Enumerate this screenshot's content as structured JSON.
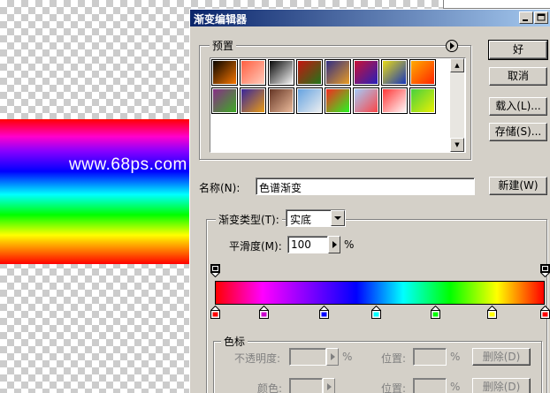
{
  "background": {
    "watermark": "www.68ps.com"
  },
  "dialog": {
    "title": "渐变编辑器",
    "presets": {
      "label": "预置",
      "swatches": [
        [
          "#000000",
          "#ff7a00"
        ],
        [
          "#ff5a3c",
          "#ffd0c0"
        ],
        [
          "#000000",
          "#ffffff"
        ],
        [
          "#cc1010",
          "#1a7a1a"
        ],
        [
          "#2a2a88",
          "#f0a020"
        ],
        [
          "#d01030",
          "#2020c0"
        ],
        [
          "#f0e010",
          "#1030c0"
        ],
        [
          "#ffb000",
          "#ff2000"
        ],
        [
          "#8a2a8a",
          "#3ab020"
        ],
        [
          "#3020a0",
          "#f0a010"
        ],
        [
          "#603020",
          "#f0c0a0"
        ],
        [
          "#60a0e0",
          "#f0f0f0"
        ],
        [
          "#ff2020",
          "#20ff20"
        ],
        [
          "#a0d0ff",
          "#ff4040"
        ],
        [
          "#ff3030",
          "#ffffff"
        ],
        [
          "#40d040",
          "#f0f000"
        ]
      ]
    },
    "buttons": {
      "ok": "好",
      "cancel": "取消",
      "load": "载入(L)...",
      "save": "存储(S)...",
      "new": "新建(W)"
    },
    "name": {
      "label": "名称(N):",
      "value": "色谱渐变"
    },
    "gradient_type": {
      "label": "渐变类型(T):",
      "value": "实底"
    },
    "smoothness": {
      "label": "平滑度(M):",
      "value": "100",
      "unit": "%"
    },
    "gradient": {
      "colors": [
        "#ff0000",
        "#ff00ff",
        "#8000ff",
        "#0000ff",
        "#00ffff",
        "#00ff00",
        "#ffff00",
        "#ff0000"
      ],
      "color_stops": [
        {
          "pos": 0,
          "color": "#ff0000"
        },
        {
          "pos": 15,
          "color": "#cc00cc"
        },
        {
          "pos": 33,
          "color": "#0000ff"
        },
        {
          "pos": 49,
          "color": "#00ffff"
        },
        {
          "pos": 67,
          "color": "#00ff00"
        },
        {
          "pos": 84,
          "color": "#ffff00"
        },
        {
          "pos": 100,
          "color": "#ff0000"
        }
      ],
      "opacity_stops": [
        0,
        100
      ]
    },
    "stops_group": {
      "label": "色标",
      "opacity_label": "不透明度:",
      "color_label": "颜色:",
      "location_label": "位置:",
      "percent": "%",
      "delete_label": "删除(D)"
    }
  }
}
